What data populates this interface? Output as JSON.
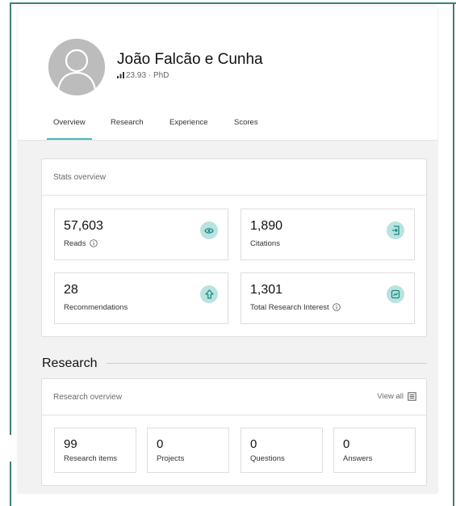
{
  "profile": {
    "name": "João Falcão e Cunha",
    "score": "23.93",
    "degree": "PhD",
    "separator": "·"
  },
  "tabs": [
    {
      "label": "Overview",
      "active": true
    },
    {
      "label": "Research",
      "active": false
    },
    {
      "label": "Experience",
      "active": false
    },
    {
      "label": "Scores",
      "active": false
    }
  ],
  "stats_overview": {
    "title": "Stats overview",
    "items": [
      {
        "value": "57,603",
        "label": "Reads",
        "icon": "eye-icon",
        "has_info": true
      },
      {
        "value": "1,890",
        "label": "Citations",
        "icon": "citation-icon",
        "has_info": false
      },
      {
        "value": "28",
        "label": "Recommendations",
        "icon": "recommend-arrow-icon",
        "has_info": false
      },
      {
        "value": "1,301",
        "label": "Total Research Interest",
        "icon": "research-interest-icon",
        "has_info": true
      }
    ]
  },
  "research_section": {
    "heading": "Research",
    "card_title": "Research overview",
    "view_all": "View all",
    "items": [
      {
        "value": "99",
        "label": "Research items"
      },
      {
        "value": "0",
        "label": "Projects"
      },
      {
        "value": "0",
        "label": "Questions"
      },
      {
        "value": "0",
        "label": "Answers"
      }
    ]
  },
  "colors": {
    "frame": "#3e7f78",
    "accent": "#40b7c2",
    "icon_bg": "#b8e3df",
    "icon_fg": "#1e8a80"
  }
}
